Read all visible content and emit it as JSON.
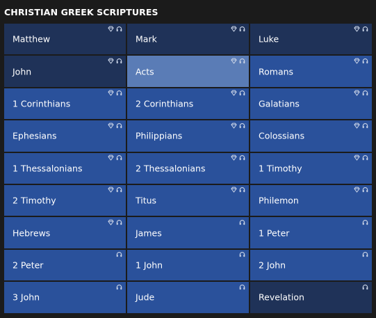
{
  "section_title": "CHRISTIAN GREEK SCRIPTURES",
  "icon_names": {
    "diamond": "diamond-icon",
    "headphones": "headphones-icon"
  },
  "colors": {
    "background": "#1b1b1b",
    "tile": "#2a519b",
    "tile_dark": "#1f3258",
    "tile_active": "#5a7cb6",
    "text": "#ffffff",
    "icon": "#c9d3e6"
  },
  "books": [
    {
      "name": "Matthew",
      "icons": [
        "diamond",
        "headphones"
      ],
      "style": "dark"
    },
    {
      "name": "Mark",
      "icons": [
        "diamond",
        "headphones"
      ],
      "style": "dark"
    },
    {
      "name": "Luke",
      "icons": [
        "diamond",
        "headphones"
      ],
      "style": "dark"
    },
    {
      "name": "John",
      "icons": [
        "diamond",
        "headphones"
      ],
      "style": "dark"
    },
    {
      "name": "Acts",
      "icons": [
        "diamond",
        "headphones"
      ],
      "style": "active"
    },
    {
      "name": "Romans",
      "icons": [
        "diamond",
        "headphones"
      ],
      "style": "normal"
    },
    {
      "name": "1 Corinthians",
      "icons": [
        "diamond",
        "headphones"
      ],
      "style": "normal"
    },
    {
      "name": "2 Corinthians",
      "icons": [
        "diamond",
        "headphones"
      ],
      "style": "normal"
    },
    {
      "name": "Galatians",
      "icons": [
        "diamond",
        "headphones"
      ],
      "style": "normal"
    },
    {
      "name": "Ephesians",
      "icons": [
        "diamond",
        "headphones"
      ],
      "style": "normal"
    },
    {
      "name": "Philippians",
      "icons": [
        "diamond",
        "headphones"
      ],
      "style": "normal"
    },
    {
      "name": "Colossians",
      "icons": [
        "diamond",
        "headphones"
      ],
      "style": "normal"
    },
    {
      "name": "1 Thessalonians",
      "icons": [
        "diamond",
        "headphones"
      ],
      "style": "normal"
    },
    {
      "name": "2 Thessalonians",
      "icons": [
        "diamond",
        "headphones"
      ],
      "style": "normal"
    },
    {
      "name": "1 Timothy",
      "icons": [
        "diamond",
        "headphones"
      ],
      "style": "normal"
    },
    {
      "name": "2 Timothy",
      "icons": [
        "diamond",
        "headphones"
      ],
      "style": "normal"
    },
    {
      "name": "Titus",
      "icons": [
        "diamond",
        "headphones"
      ],
      "style": "normal"
    },
    {
      "name": "Philemon",
      "icons": [
        "diamond",
        "headphones"
      ],
      "style": "normal"
    },
    {
      "name": "Hebrews",
      "icons": [
        "diamond",
        "headphones"
      ],
      "style": "normal"
    },
    {
      "name": "James",
      "icons": [
        "headphones"
      ],
      "style": "normal"
    },
    {
      "name": "1 Peter",
      "icons": [
        "headphones"
      ],
      "style": "normal"
    },
    {
      "name": "2 Peter",
      "icons": [
        "headphones"
      ],
      "style": "normal"
    },
    {
      "name": "1 John",
      "icons": [
        "headphones"
      ],
      "style": "normal"
    },
    {
      "name": "2 John",
      "icons": [
        "headphones"
      ],
      "style": "normal"
    },
    {
      "name": "3 John",
      "icons": [
        "headphones"
      ],
      "style": "normal"
    },
    {
      "name": "Jude",
      "icons": [
        "headphones"
      ],
      "style": "normal"
    },
    {
      "name": "Revelation",
      "icons": [
        "headphones"
      ],
      "style": "dark"
    }
  ]
}
